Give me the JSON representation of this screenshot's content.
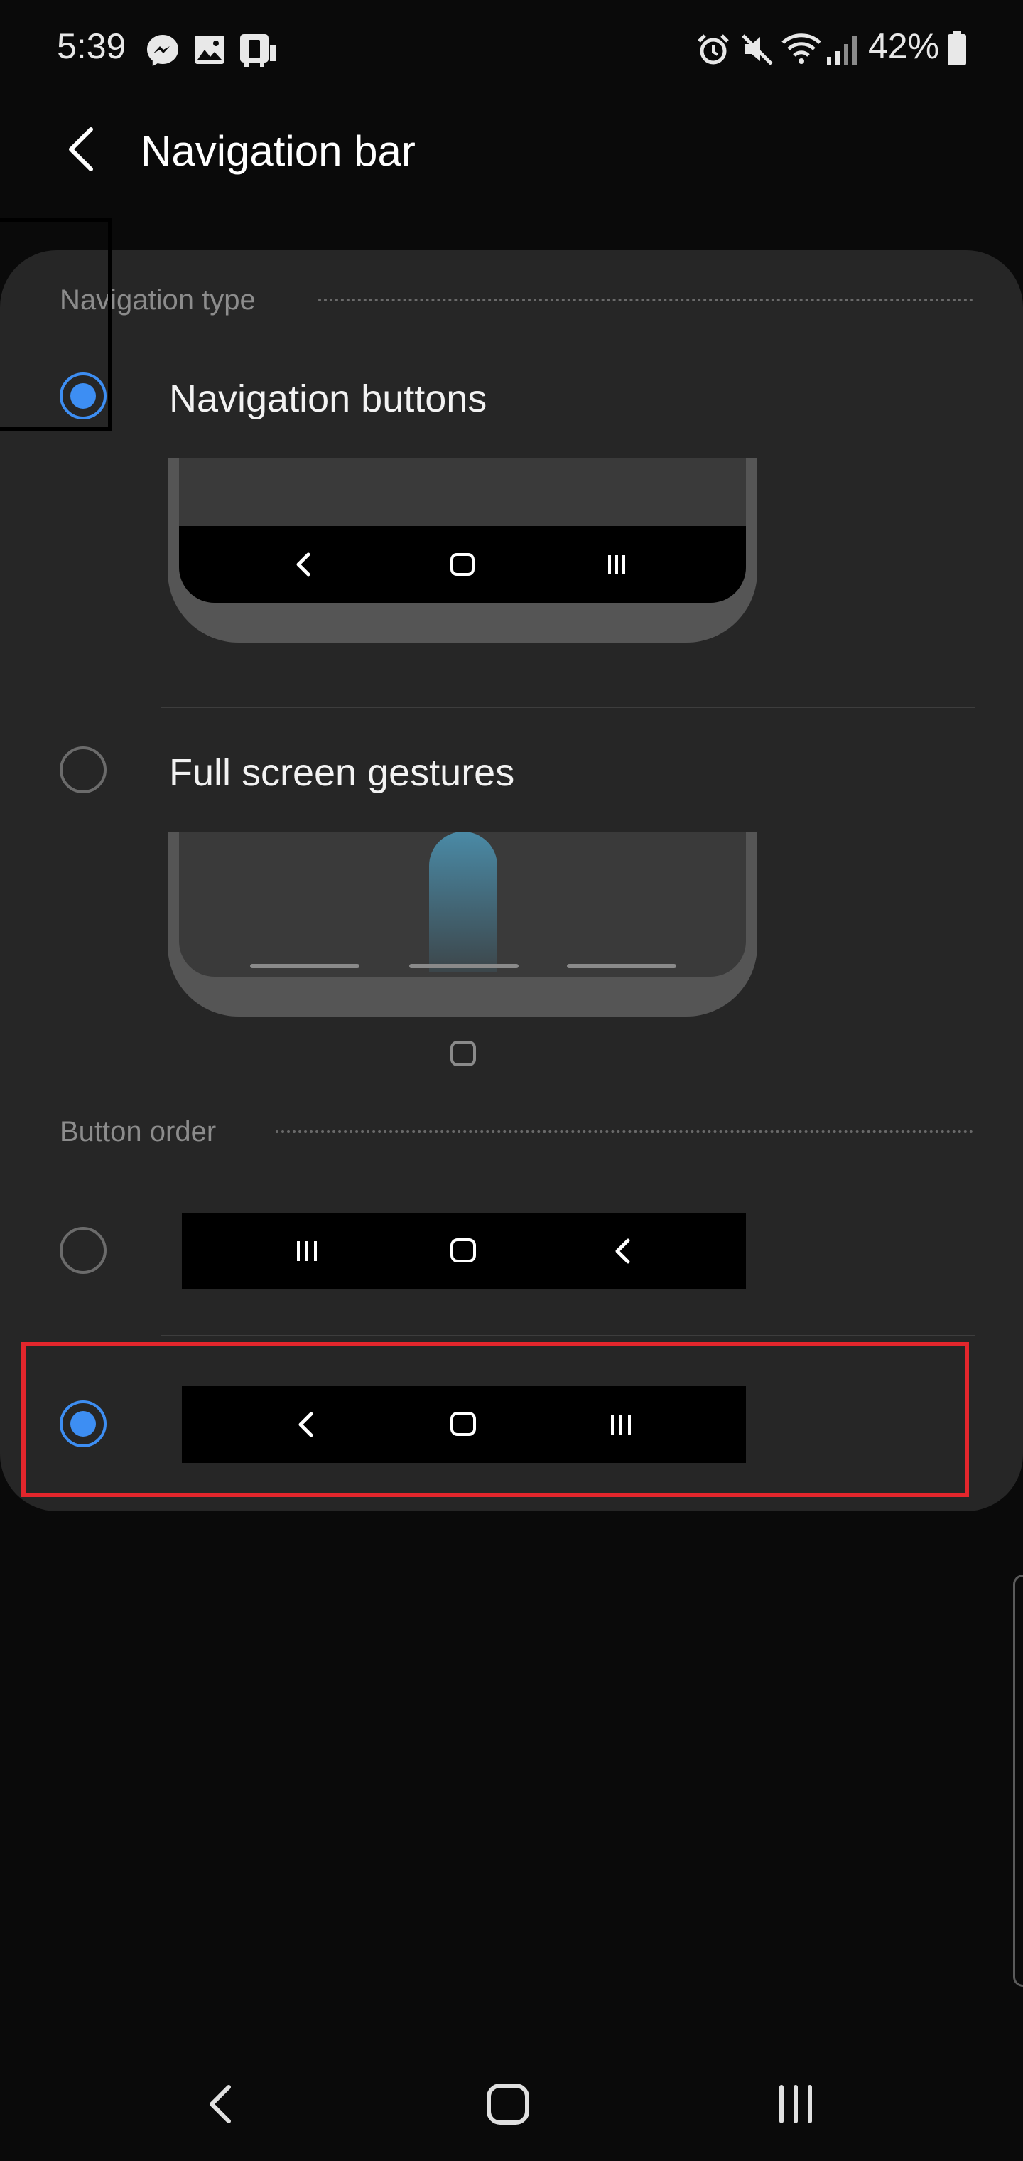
{
  "status_bar": {
    "time": "5:39",
    "battery": "42%",
    "left_icons": [
      "messenger-icon",
      "gallery-icon",
      "phone-transfer-icon"
    ],
    "right_icons": [
      "alarm-icon",
      "mute-icon",
      "wifi-icon",
      "signal-icon",
      "battery-icon"
    ]
  },
  "header": {
    "title": "Navigation bar",
    "back_icon": "back-arrow-icon"
  },
  "navigation_type": {
    "heading": "Navigation type",
    "options": [
      {
        "label": "Navigation buttons",
        "selected": true
      },
      {
        "label": "Full screen gestures",
        "selected": false
      }
    ]
  },
  "button_order": {
    "heading": "Button order",
    "options": [
      {
        "order": [
          "recents-icon",
          "home-icon",
          "back-icon"
        ],
        "selected": false
      },
      {
        "order": [
          "back-icon",
          "home-icon",
          "recents-icon"
        ],
        "selected": true
      }
    ]
  },
  "colors": {
    "accent": "#3d8ef3",
    "highlight": "#e3262c",
    "card": "#262626"
  },
  "system_nav": [
    "back-icon",
    "home-icon",
    "recents-icon"
  ]
}
